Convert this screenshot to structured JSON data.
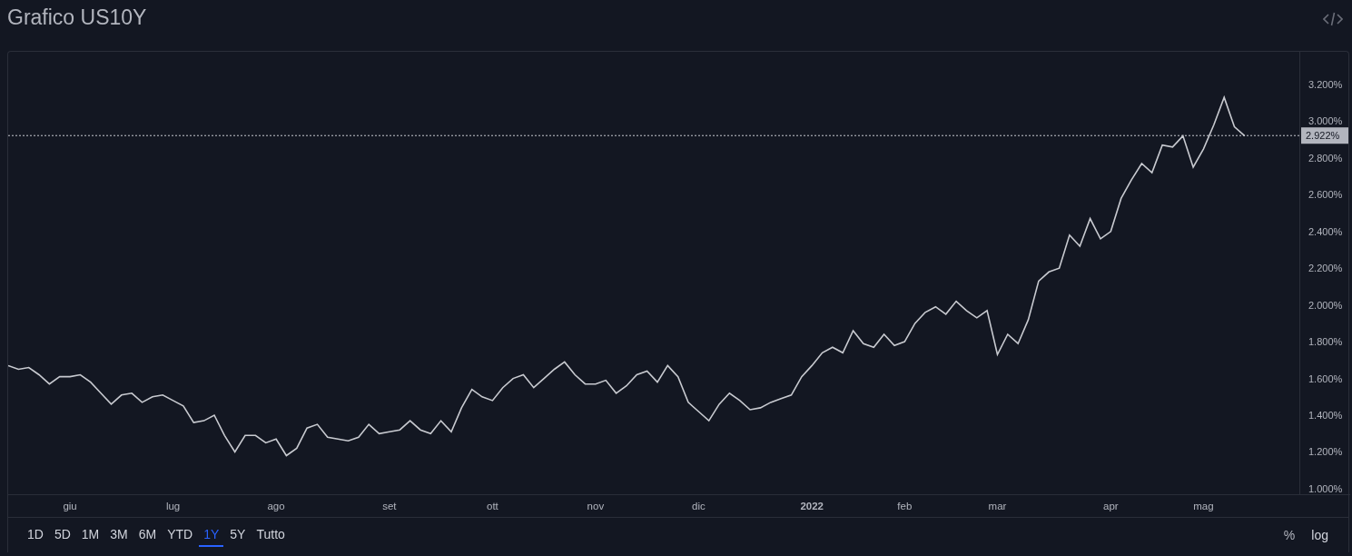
{
  "title": "Grafico US10Y",
  "chart_data": {
    "type": "line",
    "ylim": [
      0.97,
      3.378
    ],
    "categories": [
      null,
      null,
      null,
      null,
      null,
      null,
      "giu",
      null,
      null,
      null,
      null,
      null,
      null,
      null,
      null,
      null,
      "lug",
      null,
      null,
      null,
      null,
      null,
      null,
      null,
      null,
      null,
      "ago",
      null,
      null,
      null,
      null,
      null,
      null,
      null,
      null,
      null,
      null,
      "set",
      null,
      null,
      null,
      null,
      null,
      null,
      null,
      null,
      null,
      "ott",
      null,
      null,
      null,
      null,
      null,
      null,
      null,
      null,
      null,
      "nov",
      null,
      null,
      null,
      null,
      null,
      null,
      null,
      null,
      null,
      "dic",
      null,
      null,
      null,
      null,
      null,
      null,
      null,
      null,
      null,
      null,
      "2022",
      null,
      null,
      null,
      null,
      null,
      null,
      null,
      null,
      "feb",
      null,
      null,
      null,
      null,
      null,
      null,
      null,
      null,
      "mar",
      null,
      null,
      null,
      null,
      null,
      null,
      null,
      null,
      null,
      null,
      "apr",
      null,
      null,
      null,
      null,
      null,
      null,
      null,
      null,
      "mag",
      null,
      null,
      null,
      null
    ],
    "yticks": [
      {
        "value": 1.0,
        "label": "1.000%"
      },
      {
        "value": 1.2,
        "label": "1.200%"
      },
      {
        "value": 1.4,
        "label": "1.400%"
      },
      {
        "value": 1.6,
        "label": "1.600%"
      },
      {
        "value": 1.8,
        "label": "1.800%"
      },
      {
        "value": 2.0,
        "label": "2.000%"
      },
      {
        "value": 2.2,
        "label": "2.200%"
      },
      {
        "value": 2.4,
        "label": "2.400%"
      },
      {
        "value": 2.6,
        "label": "2.600%"
      },
      {
        "value": 2.8,
        "label": "2.800%"
      },
      {
        "value": 3.0,
        "label": "3.000%"
      },
      {
        "value": 3.2,
        "label": "3.200%"
      }
    ],
    "series": [
      {
        "color": "#c8cad0",
        "values": [
          1.67,
          1.65,
          1.66,
          1.62,
          1.57,
          1.61,
          1.61,
          1.62,
          1.58,
          1.52,
          1.46,
          1.51,
          1.52,
          1.47,
          1.5,
          1.51,
          1.48,
          1.45,
          1.36,
          1.37,
          1.4,
          1.29,
          1.2,
          1.29,
          1.29,
          1.25,
          1.27,
          1.18,
          1.22,
          1.33,
          1.35,
          1.28,
          1.27,
          1.26,
          1.28,
          1.35,
          1.3,
          1.31,
          1.32,
          1.37,
          1.32,
          1.3,
          1.37,
          1.31,
          1.44,
          1.54,
          1.5,
          1.48,
          1.55,
          1.6,
          1.62,
          1.55,
          1.6,
          1.65,
          1.69,
          1.62,
          1.57,
          1.57,
          1.59,
          1.52,
          1.56,
          1.62,
          1.64,
          1.58,
          1.67,
          1.61,
          1.47,
          1.42,
          1.37,
          1.46,
          1.52,
          1.48,
          1.43,
          1.44,
          1.47,
          1.49,
          1.51,
          1.61,
          1.67,
          1.74,
          1.77,
          1.74,
          1.86,
          1.79,
          1.77,
          1.84,
          1.78,
          1.8,
          1.9,
          1.96,
          1.99,
          1.95,
          2.02,
          1.97,
          1.93,
          1.97,
          1.73,
          1.84,
          1.79,
          1.92,
          2.13,
          2.18,
          2.2,
          2.38,
          2.32,
          2.47,
          2.36,
          2.4,
          2.58,
          2.68,
          2.77,
          2.72,
          2.87,
          2.86,
          2.92,
          2.75,
          2.85,
          2.98,
          3.13,
          2.97,
          2.92
        ]
      }
    ],
    "ref_lines": [
      {
        "axis": "y",
        "value": 2.922,
        "label": "2.922%"
      }
    ]
  },
  "ranges": [
    {
      "label": "1D",
      "selected": false
    },
    {
      "label": "5D",
      "selected": false
    },
    {
      "label": "1M",
      "selected": false
    },
    {
      "label": "3M",
      "selected": false
    },
    {
      "label": "6M",
      "selected": false
    },
    {
      "label": "YTD",
      "selected": false
    },
    {
      "label": "1Y",
      "selected": true
    },
    {
      "label": "5Y",
      "selected": false
    },
    {
      "label": "Tutto",
      "selected": false
    }
  ],
  "scale_options": [
    "%",
    "log"
  ]
}
